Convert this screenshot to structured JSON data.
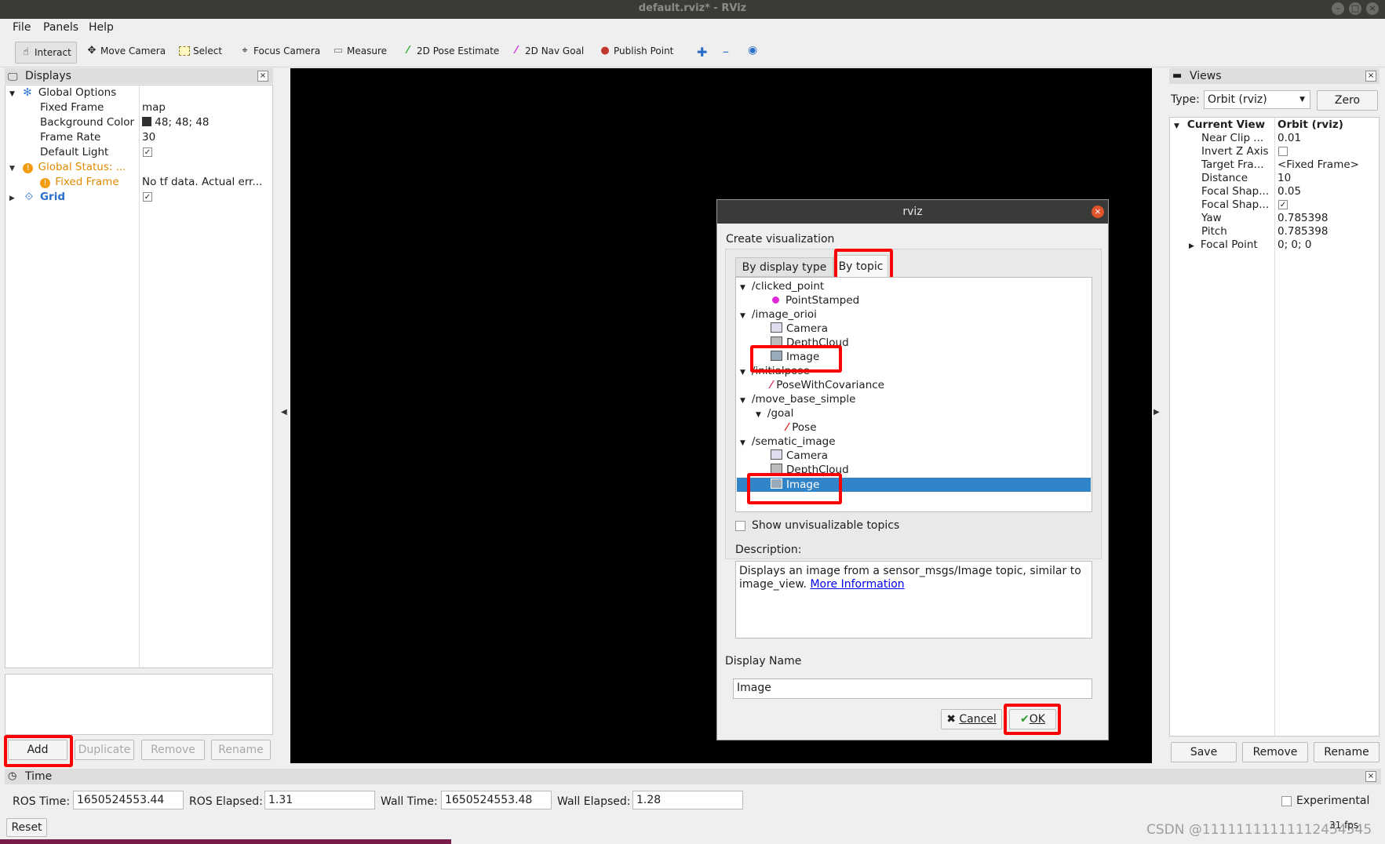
{
  "window": {
    "title": "default.rviz* - RViz"
  },
  "menubar": {
    "items": [
      "File",
      "Panels",
      "Help"
    ]
  },
  "toolbar": {
    "tools": [
      "Interact",
      "Move Camera",
      "Select",
      "Focus Camera",
      "Measure",
      "2D Pose Estimate",
      "2D Nav Goal",
      "Publish Point"
    ]
  },
  "displays": {
    "title": "Displays",
    "rows": [
      {
        "label": "Global Options",
        "value": ""
      },
      {
        "label": "Fixed Frame",
        "value": "map"
      },
      {
        "label": "Background Color",
        "value": "48; 48; 48"
      },
      {
        "label": "Frame Rate",
        "value": "30"
      },
      {
        "label": "Default Light",
        "value": "✓"
      },
      {
        "label": "Global Status: ...",
        "value": ""
      },
      {
        "label": "Fixed Frame",
        "value": "No tf data.  Actual err..."
      },
      {
        "label": "Grid",
        "value": "✓"
      }
    ],
    "buttons": {
      "add": "Add",
      "duplicate": "Duplicate",
      "remove": "Remove",
      "rename": "Rename"
    }
  },
  "views": {
    "title": "Views",
    "type_label": "Type:",
    "type_value": "Orbit (rviz)",
    "zero": "Zero",
    "rows": [
      {
        "label": "Current View",
        "value": "Orbit (rviz)"
      },
      {
        "label": "Near Clip ...",
        "value": "0.01"
      },
      {
        "label": "Invert Z Axis",
        "value": ""
      },
      {
        "label": "Target Fra...",
        "value": "<Fixed Frame>"
      },
      {
        "label": "Distance",
        "value": "10"
      },
      {
        "label": "Focal Shap...",
        "value": "0.05"
      },
      {
        "label": "Focal Shap...",
        "value": "✓"
      },
      {
        "label": "Yaw",
        "value": "0.785398"
      },
      {
        "label": "Pitch",
        "value": "0.785398"
      },
      {
        "label": "Focal Point",
        "value": "0; 0; 0"
      }
    ],
    "buttons": {
      "save": "Save",
      "remove": "Remove",
      "rename": "Rename"
    }
  },
  "time": {
    "title": "Time",
    "ros_time_label": "ROS Time:",
    "ros_time": "1650524553.44",
    "ros_elapsed_label": "ROS Elapsed:",
    "ros_elapsed": "1.31",
    "wall_time_label": "Wall Time:",
    "wall_time": "1650524553.48",
    "wall_elapsed_label": "Wall Elapsed:",
    "wall_elapsed": "1.28",
    "experimental": "Experimental",
    "reset": "Reset",
    "fps": "31 fps"
  },
  "watermark": "CSDN @11111111111112454545",
  "dialog": {
    "title": "rviz",
    "heading": "Create visualization",
    "tabs": [
      "By display type",
      "By topic"
    ],
    "topics": [
      {
        "text": "/clicked_point",
        "level": 0
      },
      {
        "text": "PointStamped",
        "level": 2
      },
      {
        "text": "/image_orioi",
        "level": 0
      },
      {
        "text": "Camera",
        "level": 2
      },
      {
        "text": "DepthCloud",
        "level": 2
      },
      {
        "text": "Image",
        "level": 2
      },
      {
        "text": "/initialpose",
        "level": 0
      },
      {
        "text": "PoseWithCovariance",
        "level": 2
      },
      {
        "text": "/move_base_simple",
        "level": 0
      },
      {
        "text": "/goal",
        "level": 1
      },
      {
        "text": "Pose",
        "level": 3
      },
      {
        "text": "/sematic_image",
        "level": 0
      },
      {
        "text": "Camera",
        "level": 2
      },
      {
        "text": "DepthCloud",
        "level": 2
      },
      {
        "text": "Image",
        "level": 2
      }
    ],
    "show_unvisualizable": "Show unvisualizable topics",
    "description_label": "Description:",
    "description_text": "Displays an image from a sensor_msgs/Image topic, similar to image_view.",
    "description_link": "More Information",
    "display_name_label": "Display Name",
    "display_name_value": "Image",
    "cancel": "Cancel",
    "ok": "OK"
  },
  "colors": {
    "selection": "#3084c7",
    "highlight": "#ff0000",
    "viewport": "#000000",
    "link": "#0000ee"
  }
}
